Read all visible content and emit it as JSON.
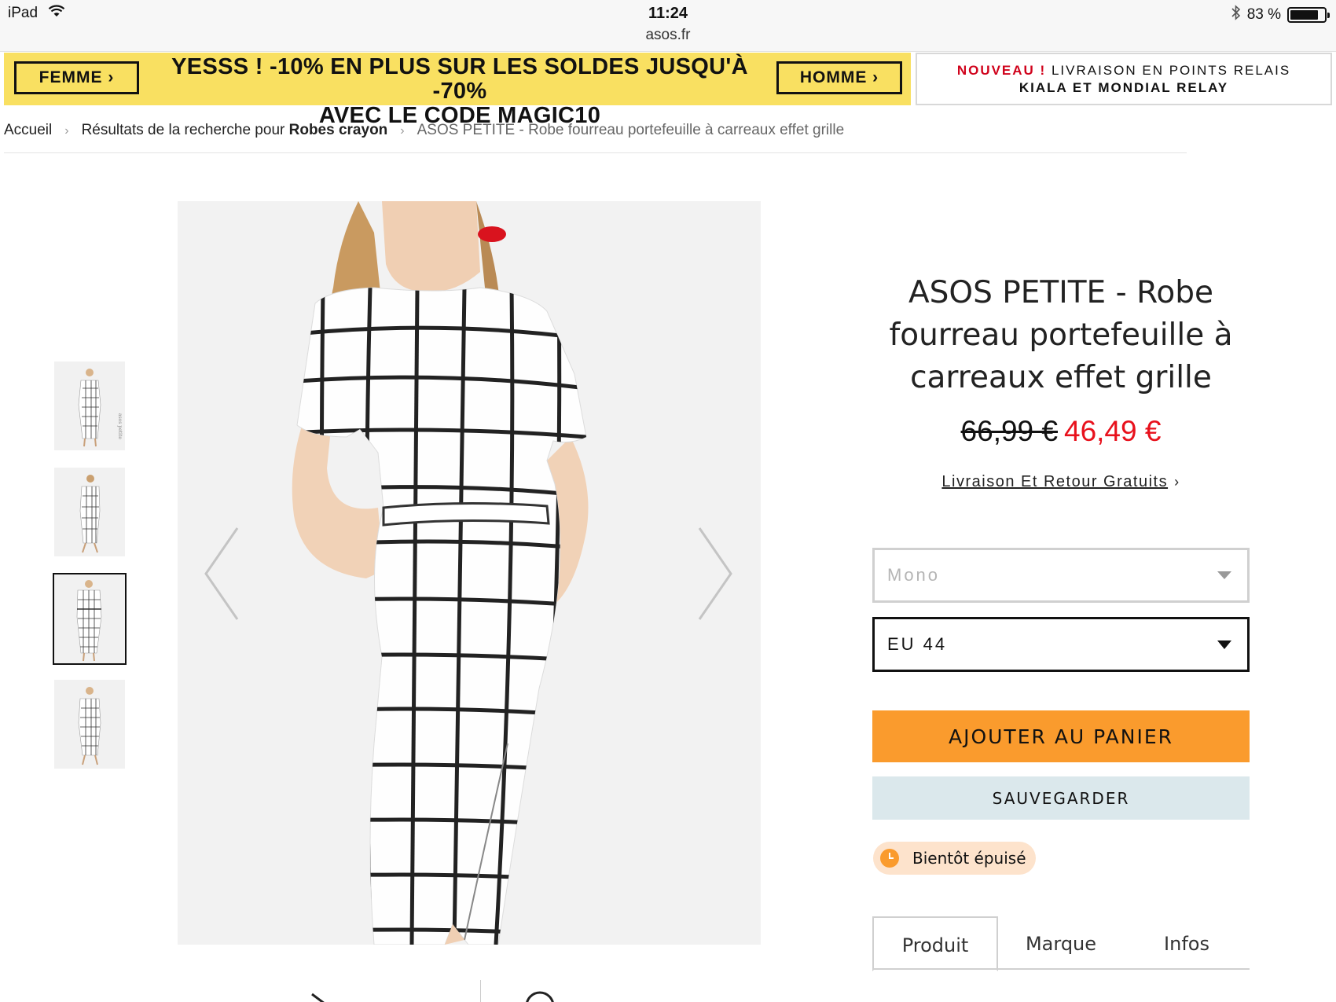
{
  "status_bar": {
    "device": "iPad",
    "time": "11:24",
    "url": "asos.fr",
    "battery": "83 %",
    "battery_level": 0.83
  },
  "promo": {
    "femme_label": "FEMME ›",
    "homme_label": "HOMME ›",
    "line1": "YESSS ! -10% EN PLUS SUR LES SOLDES JUSQU'À -70%",
    "line2": "AVEC LE CODE MAGIC10"
  },
  "relay": {
    "nouveau": "NOUVEAU !",
    "line1_rest": " LIVRAISON EN POINTS RELAIS",
    "line2": "KIALA ET MONDIAL RELAY"
  },
  "breadcrumb": {
    "home": "Accueil",
    "search_prefix": "Résultats de la recherche pour ",
    "search_term": "Robes crayon",
    "current": "ASOS PETITE - Robe fourreau portefeuille à carreaux effet grille",
    "separator": "›"
  },
  "product": {
    "title_line1": "ASOS PETITE - Robe",
    "title_line2": "fourreau portefeuille à",
    "title_line3": "carreaux effet grille",
    "price_old": "66,99 €",
    "price_new": "46,49 €",
    "shipping_link": "Livraison Et Retour Gratuits",
    "shipping_chevron": "›",
    "color_select": "Mono",
    "size_select": "EU 44",
    "add_to_cart": "AJOUTER AU PANIER",
    "save": "SAUVEGARDER",
    "stock_badge": "Bientôt épuisé"
  },
  "thumb_watermark": "asos petite",
  "tabs": [
    "Produit",
    "Marque",
    "Infos"
  ],
  "colors": {
    "promo_yellow": "#f9e061",
    "cart_orange": "#fa9b2d",
    "save_blue": "#dbe8ec",
    "price_red": "#e8111c",
    "nouveau_red": "#d0021b",
    "badge_bg": "#fde3cc"
  }
}
